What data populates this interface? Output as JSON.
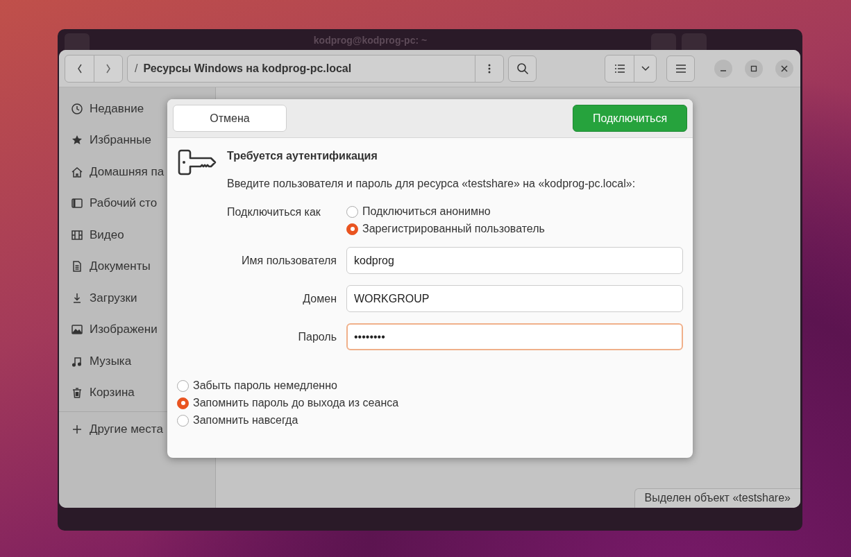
{
  "terminal": {
    "title": "kodprog@kodprog-pc: ~"
  },
  "file_manager": {
    "path_separator": "/",
    "path": "Ресурсы Windows на kodprog-pc.local",
    "sidebar": {
      "items": [
        {
          "label": "Недавние"
        },
        {
          "label": "Избранные"
        },
        {
          "label": "Домашняя па"
        },
        {
          "label": "Рабочий сто"
        },
        {
          "label": "Видео"
        },
        {
          "label": "Документы"
        },
        {
          "label": "Загрузки"
        },
        {
          "label": "Изображени"
        },
        {
          "label": "Музыка"
        },
        {
          "label": "Корзина"
        }
      ],
      "other_places": "Другие места"
    },
    "status": "Выделен объект «testshare»"
  },
  "dialog": {
    "cancel": "Отмена",
    "connect": "Подключиться",
    "title": "Требуется аутентификация",
    "message": "Введите пользователя и пароль для ресурса «testshare» на «kodprog-pc.local»:",
    "connect_as_label": "Подключиться как",
    "connect_as_options": [
      {
        "label": "Подключиться анонимно",
        "selected": false
      },
      {
        "label": "Зарегистрированный пользователь",
        "selected": true
      }
    ],
    "fields": [
      {
        "label": "Имя пользователя",
        "value": "kodprog",
        "focused": false
      },
      {
        "label": "Домен",
        "value": "WORKGROUP",
        "focused": false
      },
      {
        "label": "Пароль",
        "value": "••••••••",
        "focused": true
      }
    ],
    "remember_options": [
      {
        "label": "Забыть пароль немедленно",
        "selected": false
      },
      {
        "label": "Запомнить пароль до выхода из сеанса",
        "selected": true
      },
      {
        "label": "Запомнить навсегда",
        "selected": false
      }
    ]
  }
}
